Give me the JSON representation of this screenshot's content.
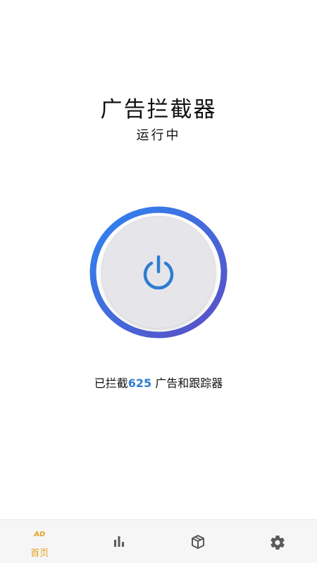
{
  "header": {
    "title": "广告拦截器",
    "status": "运行中"
  },
  "power": {
    "state": "on",
    "ring_colors": [
      "#2d7ff0",
      "#5a55c8"
    ],
    "icon_color": "#2d7dd2"
  },
  "stats": {
    "prefix": "已拦截",
    "count": "625",
    "suffix": " 广告和跟踪器"
  },
  "tabbar": {
    "tabs": [
      {
        "label": "首页",
        "icon": "ad-logo-icon",
        "active": true,
        "logo_text": "AD"
      },
      {
        "label": "",
        "icon": "bar-chart-icon",
        "active": false
      },
      {
        "label": "",
        "icon": "package-box-icon",
        "active": false
      },
      {
        "label": "",
        "icon": "gear-icon",
        "active": false
      }
    ],
    "active_color": "#e3a422",
    "inactive_color": "#5a5a5a"
  }
}
